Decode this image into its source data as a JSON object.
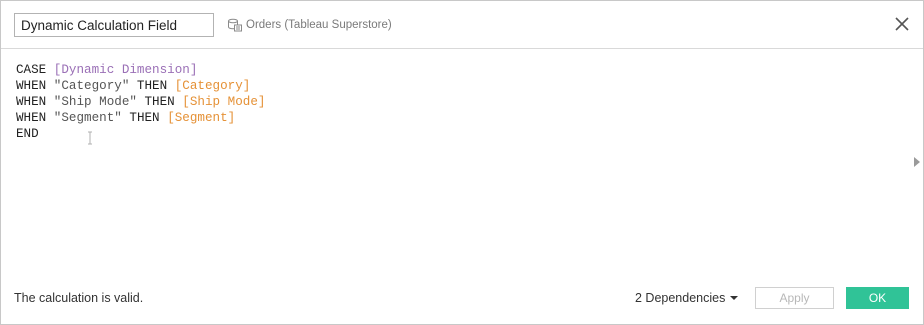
{
  "dialog": {
    "field_name": "Dynamic Calculation Field",
    "datasource_label": "Orders (Tableau Superstore)",
    "datasource_icon": "datasource-icon",
    "close_icon": "close-icon"
  },
  "editor": {
    "lines": [
      [
        {
          "text": "CASE ",
          "kind": "keyword"
        },
        {
          "text": "[Dynamic Dimension]",
          "kind": "parameter"
        }
      ],
      [
        {
          "text": "WHEN ",
          "kind": "keyword"
        },
        {
          "text": "\"Category\"",
          "kind": "string"
        },
        {
          "text": " THEN ",
          "kind": "keyword"
        },
        {
          "text": "[Category]",
          "kind": "field"
        }
      ],
      [
        {
          "text": "WHEN ",
          "kind": "keyword"
        },
        {
          "text": "\"Ship Mode\"",
          "kind": "string"
        },
        {
          "text": " THEN ",
          "kind": "keyword"
        },
        {
          "text": "[Ship Mode]",
          "kind": "field"
        }
      ],
      [
        {
          "text": "WHEN ",
          "kind": "keyword"
        },
        {
          "text": "\"Segment\"",
          "kind": "string"
        },
        {
          "text": " THEN ",
          "kind": "keyword"
        },
        {
          "text": "[Segment]",
          "kind": "field"
        }
      ],
      [
        {
          "text": "END",
          "kind": "keyword"
        }
      ]
    ],
    "colors": {
      "parameter": "#9a6fb6",
      "field": "#e59136",
      "string": "#555555",
      "keyword": "#222222"
    }
  },
  "footer": {
    "status_text": "The calculation is valid.",
    "dependencies_label": "2 Dependencies",
    "apply_label": "Apply",
    "ok_label": "OK",
    "ok_color": "#30c397",
    "apply_enabled": false
  }
}
